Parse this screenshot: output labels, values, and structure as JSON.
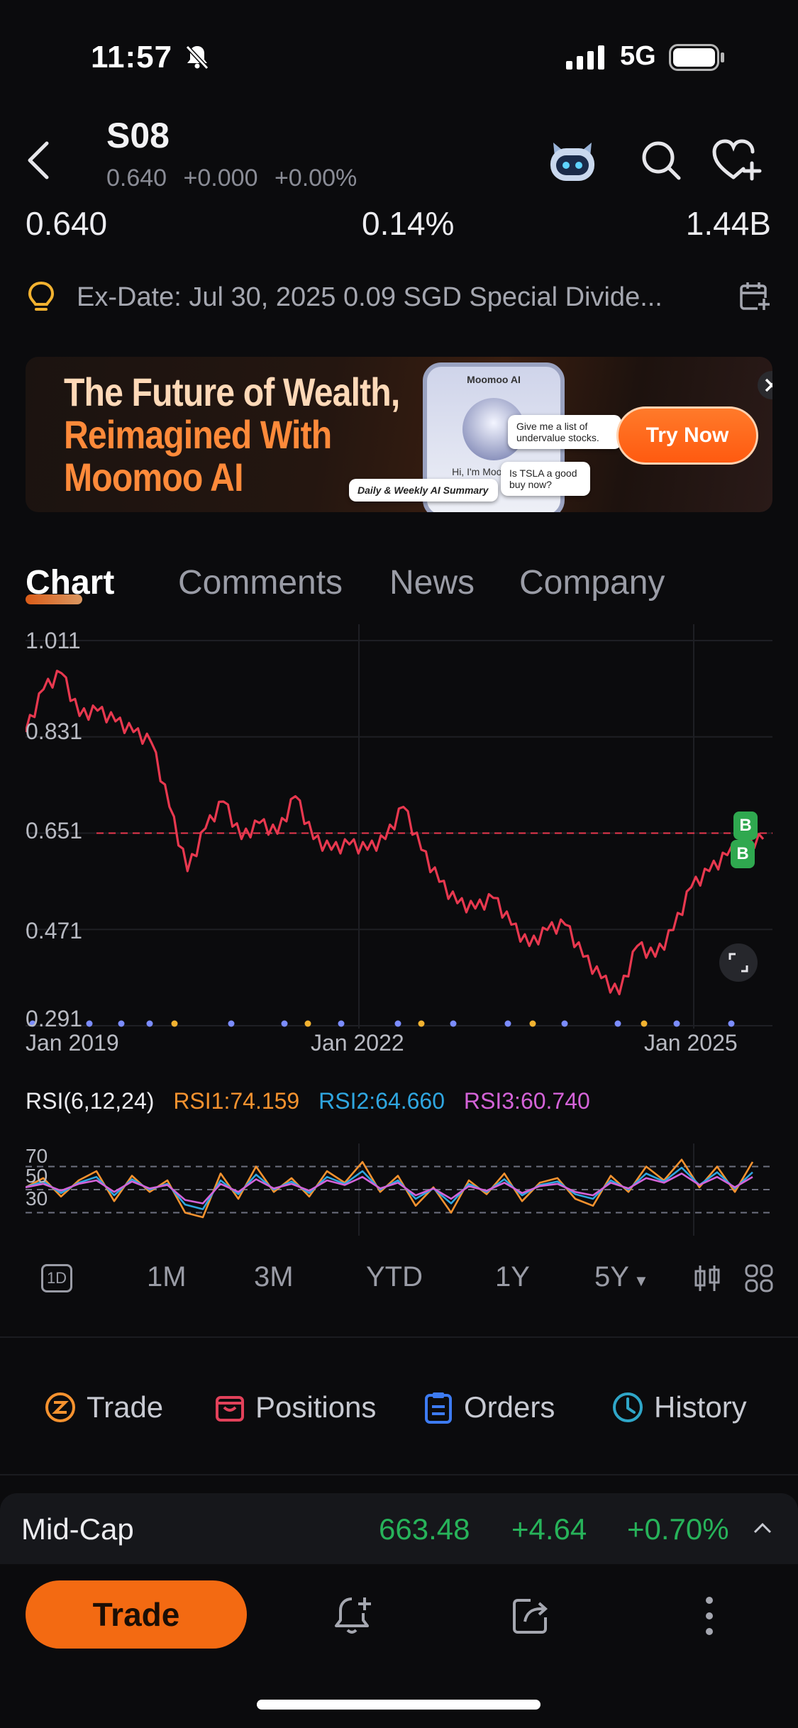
{
  "status": {
    "time": "11:57",
    "network": "5G"
  },
  "header": {
    "ticker": "S08",
    "sub_price": "0.640",
    "sub_change": "+0.000",
    "sub_change_pct": "+0.00%"
  },
  "stats": {
    "price": "0.640",
    "turnover_pct": "0.14%",
    "market_cap": "1.44B"
  },
  "notice": {
    "text": "Ex-Date: Jul 30, 2025 0.09 SGD Special Divide..."
  },
  "banner": {
    "headline_1": "The Future of Wealth,",
    "headline_2": "Reimagined With",
    "headline_3": "Moomoo AI",
    "phone_title": "Moomoo AI",
    "phone_greeting": "Hi, I'm Moomoo AI.",
    "bubble_1": "Give me a list of undervalue stocks.",
    "bubble_2": "Is TSLA a good buy now?",
    "bubble_3": "Daily & Weekly AI Summary",
    "cta": "Try Now"
  },
  "tabs": [
    "Chart",
    "Comments",
    "News",
    "Company"
  ],
  "chart_data": [
    {
      "type": "line",
      "y_ticks": [
        "1.011",
        "0.831",
        "0.651",
        "0.471",
        "0.291"
      ],
      "x_ticks": [
        "Jan 2019",
        "Jan 2022",
        "Jan 2025"
      ],
      "ylim": [
        0.291,
        1.011
      ],
      "reference_line": 0.651,
      "markers": [
        "B",
        "B"
      ],
      "series": [
        {
          "color": "#e8384f",
          "x": [
            "2018-09",
            "2018-11",
            "2019-01",
            "2019-03",
            "2019-05",
            "2019-07",
            "2019-09",
            "2019-11",
            "2020-01",
            "2020-03",
            "2020-05",
            "2020-07",
            "2020-09",
            "2020-11",
            "2021-01",
            "2021-03",
            "2021-05",
            "2021-07",
            "2021-09",
            "2021-11",
            "2022-01",
            "2022-03",
            "2022-05",
            "2022-07",
            "2022-09",
            "2022-11",
            "2023-01",
            "2023-03",
            "2023-05",
            "2023-07",
            "2023-09",
            "2023-11",
            "2024-01",
            "2024-03",
            "2024-05",
            "2024-07",
            "2024-09",
            "2024-11",
            "2025-01",
            "2025-03",
            "2025-05",
            "2025-07"
          ],
          "values": [
            0.84,
            0.92,
            0.95,
            0.87,
            0.88,
            0.86,
            0.84,
            0.82,
            0.7,
            0.58,
            0.66,
            0.71,
            0.64,
            0.67,
            0.65,
            0.72,
            0.64,
            0.62,
            0.63,
            0.62,
            0.64,
            0.7,
            0.62,
            0.56,
            0.52,
            0.51,
            0.53,
            0.48,
            0.44,
            0.47,
            0.48,
            0.42,
            0.38,
            0.35,
            0.44,
            0.42,
            0.47,
            0.55,
            0.58,
            0.61,
            0.63,
            0.64
          ]
        }
      ]
    },
    {
      "type": "line",
      "title": "RSI(6,12,24)",
      "y_ticks": [
        "70",
        "50",
        "30"
      ],
      "ylim": [
        10,
        90
      ],
      "series": [
        {
          "name": "RSI1",
          "latest": "74.159",
          "color": "#f5922f",
          "values": [
            52,
            60,
            44,
            58,
            66,
            40,
            62,
            48,
            58,
            30,
            26,
            64,
            42,
            70,
            48,
            60,
            44,
            66,
            56,
            74,
            48,
            62,
            36,
            52,
            30,
            58,
            46,
            64,
            40,
            56,
            60,
            42,
            36,
            62,
            48,
            70,
            58,
            76,
            52,
            70,
            48,
            74
          ]
        },
        {
          "name": "RSI2",
          "latest": "64.660",
          "color": "#2fa6e0",
          "values": [
            52,
            57,
            47,
            56,
            61,
            45,
            59,
            50,
            55,
            37,
            33,
            58,
            46,
            63,
            50,
            57,
            47,
            61,
            55,
            66,
            50,
            58,
            42,
            51,
            38,
            55,
            48,
            59,
            45,
            54,
            57,
            46,
            42,
            58,
            50,
            64,
            57,
            69,
            54,
            65,
            51,
            65
          ]
        },
        {
          "name": "RSI3",
          "latest": "60.740",
          "color": "#d463d8",
          "values": [
            52,
            55,
            49,
            55,
            58,
            48,
            57,
            51,
            54,
            41,
            38,
            55,
            48,
            59,
            51,
            55,
            49,
            58,
            54,
            61,
            51,
            56,
            45,
            51,
            42,
            53,
            49,
            56,
            47,
            53,
            55,
            48,
            45,
            56,
            51,
            60,
            56,
            64,
            54,
            61,
            52,
            61
          ]
        }
      ]
    }
  ],
  "periods": [
    "1D",
    "1M",
    "3M",
    "YTD",
    "1Y",
    "5Y"
  ],
  "actions": [
    "Trade",
    "Positions",
    "Orders",
    "History"
  ],
  "index": {
    "name": "Mid-Cap",
    "value": "663.48",
    "change": "+4.64",
    "change_pct": "+0.70%"
  },
  "bottom": {
    "trade": "Trade"
  },
  "colors": {
    "accent": "#f36a12",
    "up": "#27b35a",
    "down": "#e8384f"
  }
}
